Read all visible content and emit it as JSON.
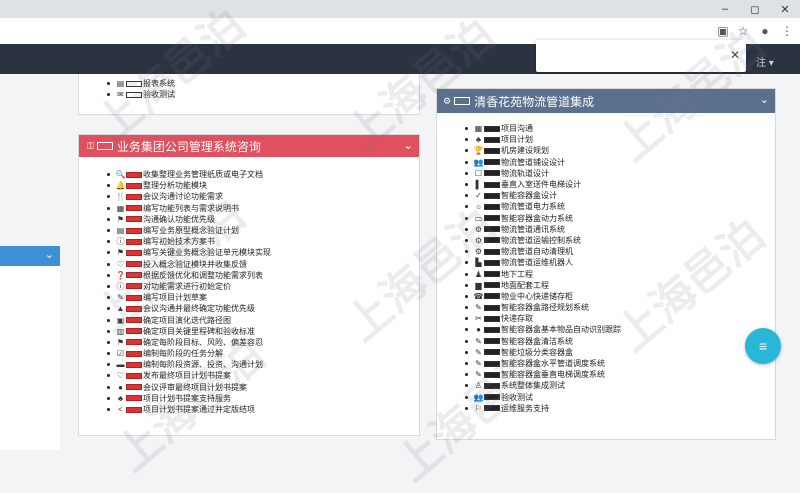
{
  "browser": {
    "window_controls": [
      "–",
      "◻",
      "✕"
    ],
    "toolbar_icons": [
      "translate-icon",
      "star-icon",
      "account-icon",
      "menu-icon"
    ]
  },
  "navbar": {
    "right_text": "注 ▾"
  },
  "popup": {
    "close": "✕"
  },
  "top_partial_card": {
    "items": [
      {
        "icon": "▤",
        "text": "报表系统"
      },
      {
        "icon": "✉",
        "text": "验收测试"
      }
    ]
  },
  "card_consult": {
    "title": "业务集团公司管理系统咨询",
    "head_color": "#e0505e",
    "items": [
      {
        "icon": "🔍",
        "text": "收集整理业务管理纸质或电子文档"
      },
      {
        "icon": "🔔",
        "text": "整理分析功能模块"
      },
      {
        "icon": "🍴",
        "text": "会议沟通讨论功能需求"
      },
      {
        "icon": "▦",
        "text": "编写功能列表与需求说明书"
      },
      {
        "icon": "⚑",
        "text": "沟通确认功能优先级"
      },
      {
        "icon": "▤",
        "text": "编写业务原型概念验证计划"
      },
      {
        "icon": "ⓘ",
        "text": "编写初始技术方案书"
      },
      {
        "icon": "⚑",
        "text": "编写关键业务概念验证单元模块实现"
      },
      {
        "icon": "♡",
        "text": "投入概念验证模块并收集反馈"
      },
      {
        "icon": "❓",
        "text": "根据反馈优化和调整功能需求列表"
      },
      {
        "icon": "ⓘ",
        "text": "对功能需求进行初始定价"
      },
      {
        "icon": "✎",
        "text": "编写项目计划草案"
      },
      {
        "icon": "▲",
        "text": "会议沟通并最终确定功能优先级"
      },
      {
        "icon": "▣",
        "text": "确定项目演化迭代路径图"
      },
      {
        "icon": "▥",
        "text": "确定项目关键里程碑和验收标准"
      },
      {
        "icon": "⚑",
        "text": "确定每阶段目标、风险、偏差容忍"
      },
      {
        "icon": "☑",
        "text": "编制每阶段的任务分解"
      },
      {
        "icon": "▬",
        "text": "编制每阶段资源、投资、沟通计划"
      },
      {
        "icon": "♡",
        "text": "发布最终项目计划书提案"
      },
      {
        "icon": "●",
        "text": "会议评审最终项目计划书提案"
      },
      {
        "icon": "♣",
        "text": "项目计划书提案支持服务"
      },
      {
        "icon": "<",
        "text": "项目计划书提案通过并定版结项"
      }
    ]
  },
  "card_logistics": {
    "title": "清香花苑物流管道集成",
    "head_color": "#5b6f8e",
    "items": [
      {
        "icon": "▦",
        "text": "项目沟通"
      },
      {
        "icon": "♣",
        "text": "项目计划"
      },
      {
        "icon": "🏆",
        "text": "机房建设规划"
      },
      {
        "icon": "👥",
        "text": "物流管道铺设设计"
      },
      {
        "icon": "☐",
        "text": "物流轨道设计"
      },
      {
        "icon": "▌",
        "text": "垂直入室送件电梯设计"
      },
      {
        "icon": "✓",
        "text": "智能容器盒设计"
      },
      {
        "icon": "☼",
        "text": "物流管道电力系统"
      },
      {
        "icon": "▭",
        "text": "智能容器盒动力系统"
      },
      {
        "icon": "⚙",
        "text": "物流管道通讯系统"
      },
      {
        "icon": "⚙",
        "text": "物流管道运输控制系统"
      },
      {
        "icon": "⚙",
        "text": "物流管道自动清理机"
      },
      {
        "icon": "▙",
        "text": "物流管道运维机器人"
      },
      {
        "icon": "♟",
        "text": "地下工程"
      },
      {
        "icon": "▆",
        "text": "地面配套工程"
      },
      {
        "icon": "☎",
        "text": "物业中心快递储存柜"
      },
      {
        "icon": "✎",
        "text": "智能容器盒路径规划系统"
      },
      {
        "icon": "✂",
        "text": "快递存取"
      },
      {
        "icon": "●",
        "text": "智能容器盒基本物品自动识别跟踪"
      },
      {
        "icon": "✎",
        "text": "智能容器盒清洁系统"
      },
      {
        "icon": "✎",
        "text": "智能垃圾分类容器盒"
      },
      {
        "icon": "✎",
        "text": "智能容器盒水平管道调度系统"
      },
      {
        "icon": "✎",
        "text": "智能容器盒垂直电梯调度系统"
      },
      {
        "icon": "♙",
        "text": "系统整体集成测试"
      },
      {
        "icon": "👥",
        "text": "验收测试"
      },
      {
        "icon": "⚐",
        "text": "运维服务支持"
      }
    ]
  },
  "fab": {
    "icon": "≡"
  },
  "watermark": "上海邑泊"
}
